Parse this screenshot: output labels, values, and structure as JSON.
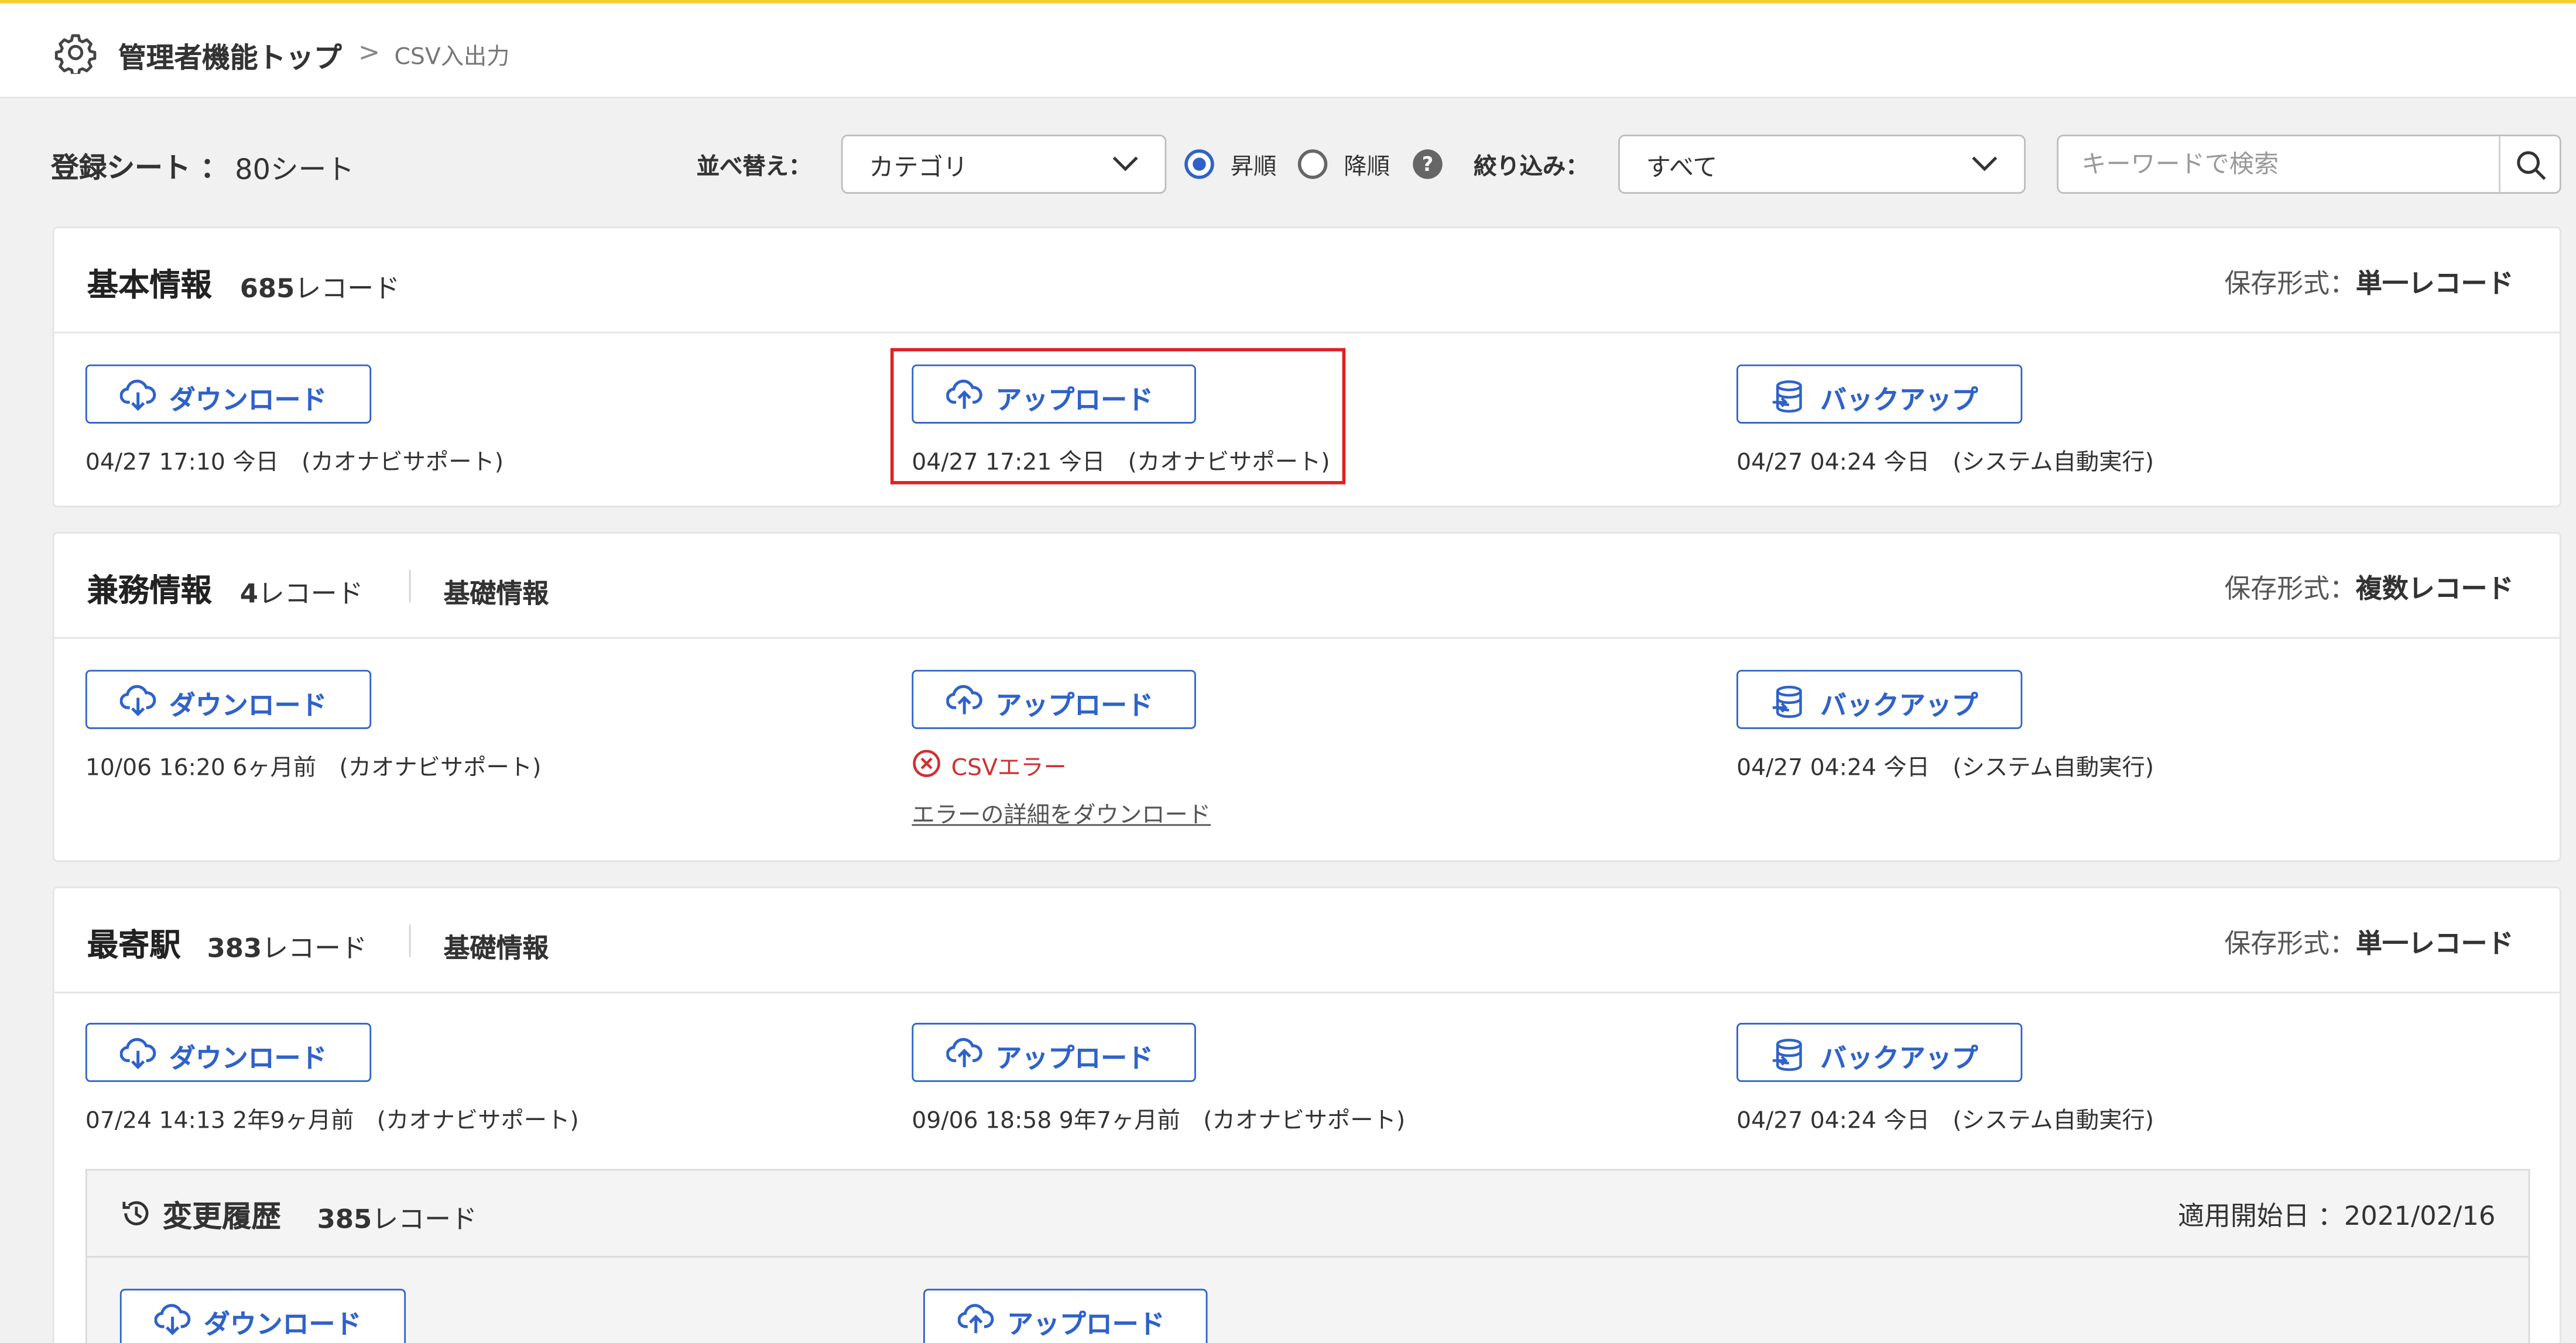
{
  "breadcrumb": {
    "root": "管理者機能トップ",
    "separator": ">",
    "current": "CSV入出力"
  },
  "toolbar": {
    "sheets_label": "登録シート ：",
    "sheets_value": "80シート",
    "sort_label": "並べ替え：",
    "sort_value": "カテゴリ",
    "asc_label": "昇順",
    "desc_label": "降順",
    "help_icon": "?",
    "filter_label": "絞り込み：",
    "filter_value": "すべて",
    "search_placeholder": "キーワードで検索"
  },
  "buttons": {
    "download": "ダウンロード",
    "upload": "アップロード",
    "backup": "バックアップ"
  },
  "cards": [
    {
      "title": "基本情報",
      "count_num": "685",
      "count_unit": "レコード",
      "category": "",
      "format_key": "保存形式：",
      "format_value": "単一レコード",
      "download_meta": "04/27 17:10 今日　(カオナビサポート)",
      "upload_meta": "04/27 17:21 今日　(カオナビサポート)",
      "backup_meta": "04/27 04:24 今日　(システム自動実行)"
    },
    {
      "title": "兼務情報",
      "count_num": "4",
      "count_unit": "レコード",
      "category": "基礎情報",
      "format_key": "保存形式：",
      "format_value": "複数レコード",
      "download_meta": "10/06 16:20 6ヶ月前　(カオナビサポート)",
      "upload_error": "CSVエラー",
      "upload_error_link": "エラーの詳細をダウンロード",
      "backup_meta": "04/27 04:24 今日　(システム自動実行)"
    },
    {
      "title": "最寄駅",
      "count_num": "383",
      "count_unit": "レコード",
      "category": "基礎情報",
      "format_key": "保存形式：",
      "format_value": "単一レコード",
      "download_meta": "07/24 14:13 2年9ヶ月前　(カオナビサポート)",
      "upload_meta": "09/06 18:58 9年7ヶ月前　(カオナビサポート)",
      "backup_meta": "04/27 04:24 今日　(システム自動実行)",
      "history": {
        "title": "変更履歴",
        "count_num": "385",
        "count_unit": "レコード",
        "start_label": "適用開始日 ：",
        "start_value": "2021/02/16"
      }
    }
  ],
  "colors": {
    "accent": "#2f62c9",
    "error": "#d03030",
    "highlight": "#e02020",
    "header_stripe": "#f5cc2a"
  }
}
